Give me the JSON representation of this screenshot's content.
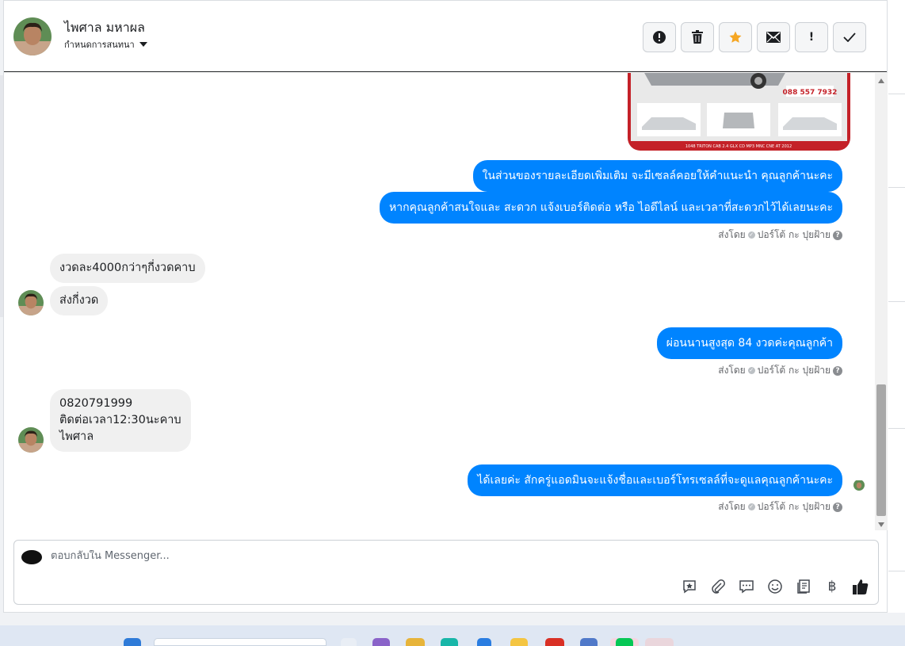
{
  "header": {
    "contact_name": "ไพศาล มหาผล",
    "assign_label": "กำหนดการสนทนา",
    "actions": [
      {
        "name": "spam-icon",
        "glyph": "!"
      },
      {
        "name": "trash-icon",
        "glyph": "🗑"
      },
      {
        "name": "star-icon",
        "glyph": "★"
      },
      {
        "name": "mail-icon",
        "glyph": "✉"
      },
      {
        "name": "exclamation-icon",
        "glyph": "!"
      },
      {
        "name": "checkmark-icon",
        "glyph": "✓"
      }
    ]
  },
  "image_caption": "1048 TRITON CAB 2.4 GLX CD MP3 MNC CNE AT 2012",
  "image_phone": "088 557 7932",
  "messages": [
    {
      "dir": "out",
      "text": "ในส่วนของรายละเอียดเพิ่มเติม จะมีเซลล์คอยให้คำแนะนำ คุณลูกค้านะคะ"
    },
    {
      "dir": "out",
      "text": "หากคุณลูกค้าสนใจและ สะดวก แจ้งเบอร์ติดต่อ หรือ ไอดีไลน์ และเวลาที่สะดวกไว้ได้เลยนะคะ"
    },
    {
      "dir": "in",
      "text": "งวดละ4000กว่าๆกี่งวดคาบ"
    },
    {
      "dir": "in",
      "text": "ส่งกี่งวด"
    },
    {
      "dir": "out",
      "text": "ผ่อนนานสูงสุด 84 งวดค่ะคุณลูกค้า"
    },
    {
      "dir": "in",
      "text": "0820791999\nติดต่อเวลา12:30นะคาบ\nไพศาล"
    },
    {
      "dir": "out",
      "text": "ได้เลยค่ะ สักครู่แอดมินจะแจ้งชื่อและเบอร์โทรเซลล์ที่จะดูแลคุณลูกค้านะคะ"
    }
  ],
  "sent_by": {
    "prefix": "ส่งโดย",
    "name": "ปอร์โต้ กะ ปุยฝ้าย"
  },
  "composer": {
    "placeholder": "ตอบกลับใน Messenger...",
    "tools": [
      {
        "name": "saved-reply-icon",
        "glyph": "✎"
      },
      {
        "name": "attachment-icon",
        "glyph": "📎"
      },
      {
        "name": "quick-reply-icon",
        "glyph": "💬"
      },
      {
        "name": "emoji-icon",
        "glyph": "☺"
      },
      {
        "name": "catalog-icon",
        "glyph": "▤"
      },
      {
        "name": "baht-icon",
        "glyph": "฿"
      },
      {
        "name": "thumbs-up-icon",
        "glyph": "👍"
      }
    ]
  },
  "colors": {
    "outgoing": "#0084ff",
    "incoming": "#f0f0f0",
    "star": "#f5a623"
  }
}
